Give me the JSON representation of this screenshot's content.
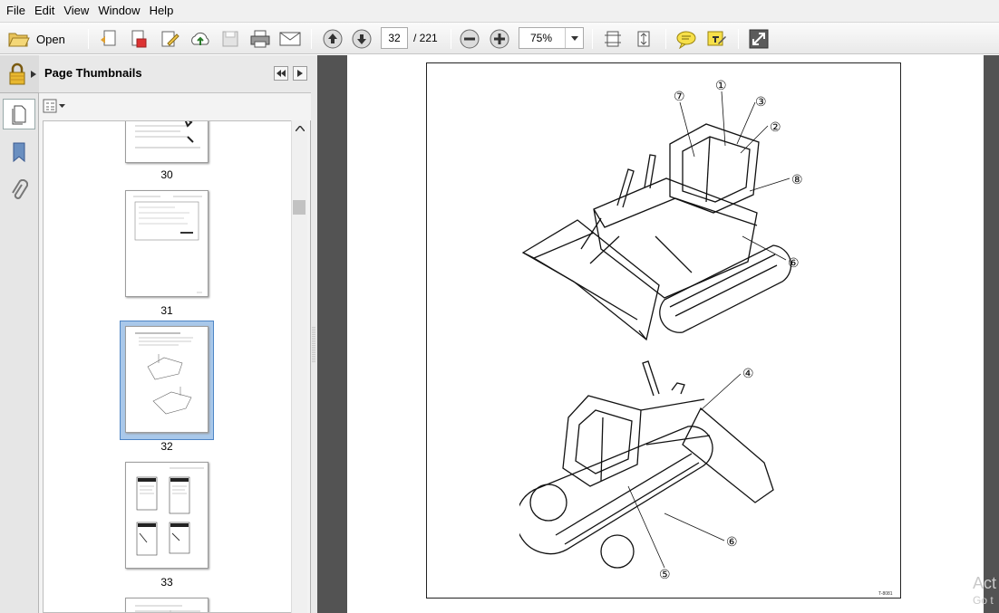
{
  "menu": [
    "File",
    "Edit",
    "View",
    "Window",
    "Help"
  ],
  "toolbar": {
    "open_label": "Open",
    "current_page": "32",
    "page_total": "/  221",
    "zoom": "75%"
  },
  "panel": {
    "title": "Page Thumbnails",
    "thumbnails": [
      {
        "label": "30"
      },
      {
        "label": "31"
      },
      {
        "label": "32",
        "selected": true
      },
      {
        "label": "33"
      }
    ]
  },
  "document": {
    "callouts_top": [
      "①",
      "②",
      "③",
      "⑥",
      "⑦",
      "⑧"
    ],
    "callouts_bottom": [
      "④",
      "⑤",
      "⑥"
    ],
    "page_code": "T-8081"
  },
  "watermark": {
    "line1": "Act",
    "line2": "Go t"
  },
  "colors": {
    "selection": "#a9c8ea",
    "doc_background": "#535353"
  },
  "icons": [
    "open-folder-icon",
    "create-pdf-icon",
    "export-icon",
    "edit-icon",
    "cloud-icon",
    "save-icon",
    "print-icon",
    "email-icon",
    "page-up-icon",
    "page-down-icon",
    "zoom-out-icon",
    "zoom-in-icon",
    "fit-page-icon",
    "fit-width-icon",
    "comment-icon",
    "sign-icon",
    "fullscreen-icon",
    "lock-icon",
    "pages-icon",
    "bookmark-icon",
    "attachment-icon"
  ]
}
